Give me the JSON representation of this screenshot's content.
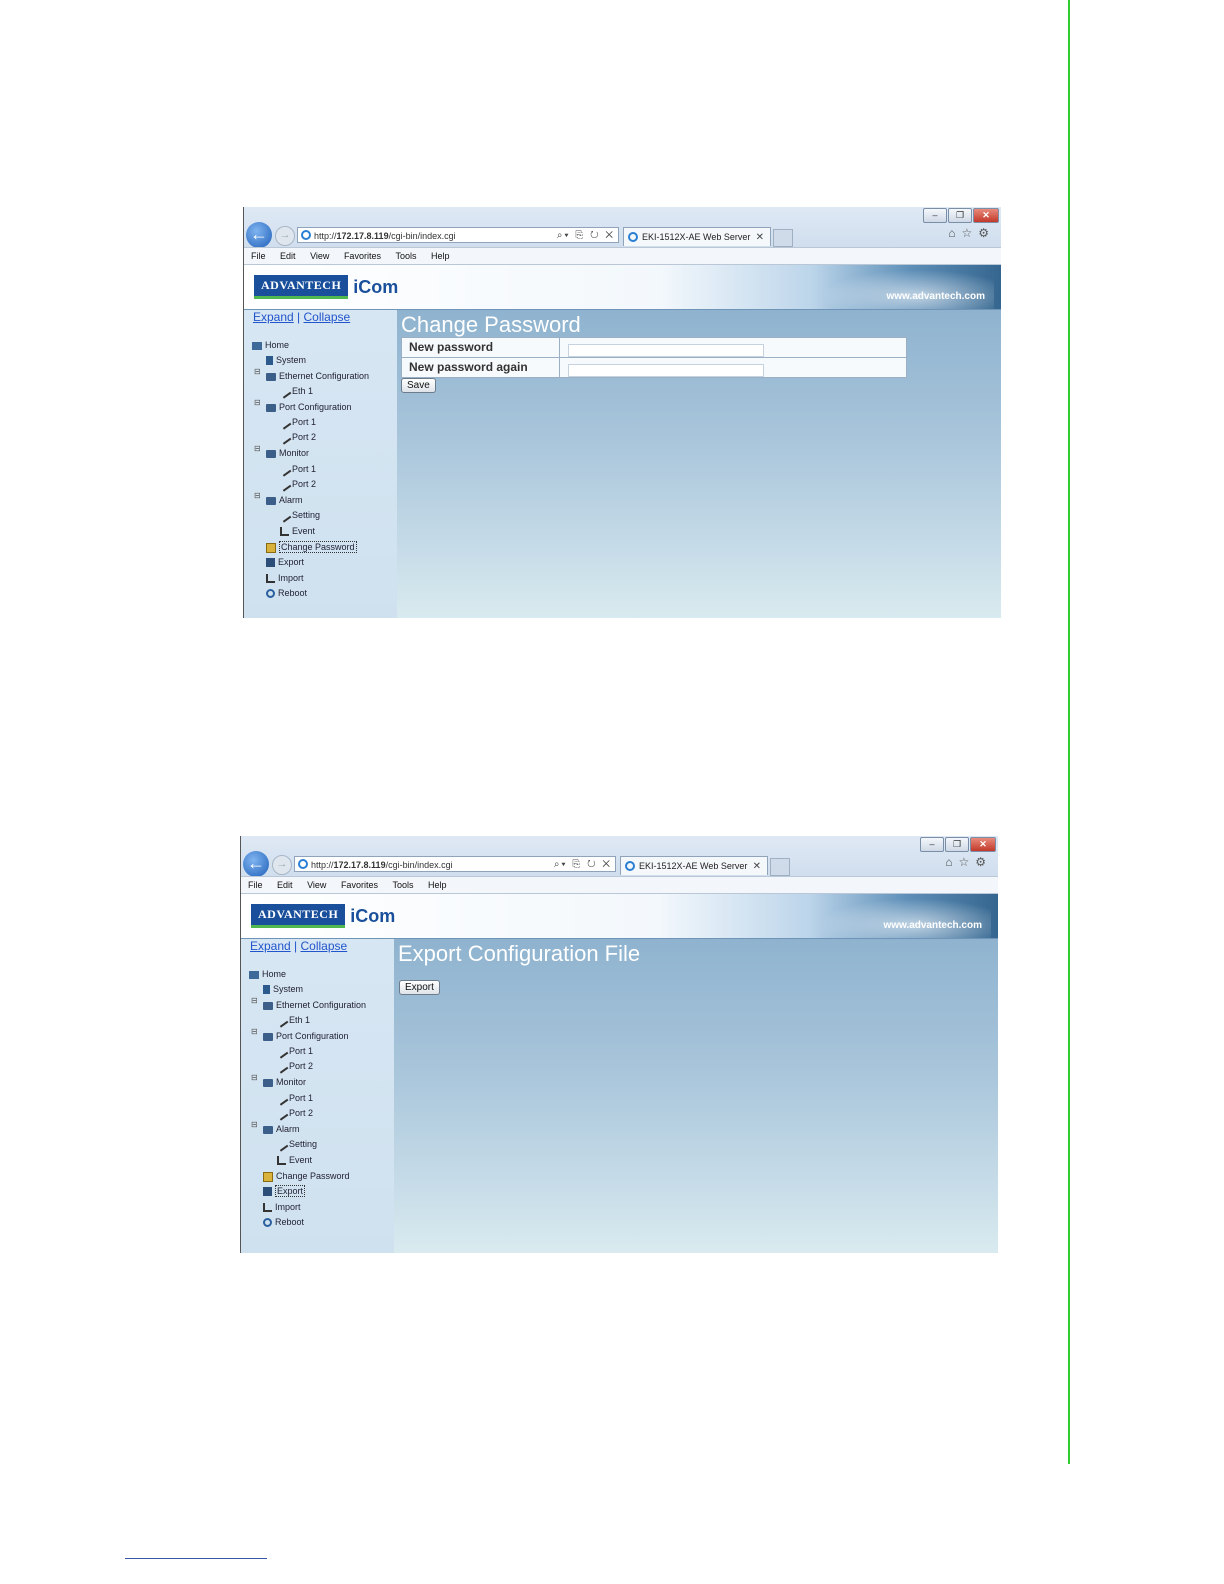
{
  "browser": {
    "address_prefix": "http://",
    "address_host": "172.17.8.119",
    "address_path": "/cgi-bin/index.cgi",
    "tab_title": "EKI-1512X-AE Web Server",
    "menu": [
      "File",
      "Edit",
      "View",
      "Favorites",
      "Tools",
      "Help"
    ]
  },
  "brand": {
    "logo_left": "ADVANTECH",
    "logo_right": "iCom",
    "site": "www.advantech.com"
  },
  "sidebar": {
    "expand": "Expand",
    "collapse": "Collapse",
    "tree": [
      {
        "label": "Home",
        "icon": "home-icon"
      },
      {
        "label": "System",
        "icon": "page-icon"
      },
      {
        "label": "Ethernet Configuration",
        "icon": "folder-icon"
      },
      {
        "label": "Eth 1",
        "icon": "wrench-icon"
      },
      {
        "label": "Port Configuration",
        "icon": "folder-icon"
      },
      {
        "label": "Port 1",
        "icon": "wrench-icon"
      },
      {
        "label": "Port 2",
        "icon": "wrench-icon"
      },
      {
        "label": "Monitor",
        "icon": "folder-icon"
      },
      {
        "label": "Port 1",
        "icon": "wrench-icon"
      },
      {
        "label": "Port 2",
        "icon": "wrench-icon"
      },
      {
        "label": "Alarm",
        "icon": "folder-icon"
      },
      {
        "label": "Setting",
        "icon": "tools-icon"
      },
      {
        "label": "Event",
        "icon": "event-icon"
      },
      {
        "label": "Change Password",
        "icon": "key-icon"
      },
      {
        "label": "Export",
        "icon": "save-icon"
      },
      {
        "label": "Import",
        "icon": "import-icon"
      },
      {
        "label": "Reboot",
        "icon": "reboot-icon"
      }
    ]
  },
  "screen1": {
    "title": "Change Password",
    "fields": [
      {
        "label": "New password",
        "value": ""
      },
      {
        "label": "New password again",
        "value": ""
      }
    ],
    "save_label": "Save"
  },
  "screen2": {
    "title": "Export Configuration File",
    "export_label": "Export"
  }
}
